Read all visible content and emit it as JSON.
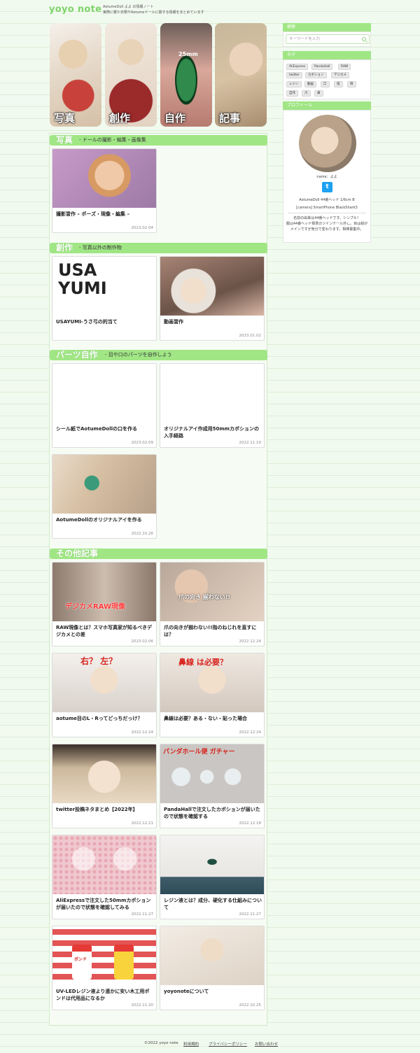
{
  "site": {
    "logo": "yoyo note",
    "tagline": "AotumeDoll よよ の情報ノート\n実際に着た衣類やAotumeドールに関する情報をまとめています"
  },
  "hero": [
    {
      "label": "写真",
      "marker": ""
    },
    {
      "label": "創作",
      "marker": ""
    },
    {
      "label": "自作",
      "marker": "25mm"
    },
    {
      "label": "記事",
      "marker": ""
    }
  ],
  "sections": {
    "photo": {
      "title": "写真",
      "sub": "- ドールの撮影・編集・画像集",
      "cards": [
        {
          "title": "撮影習作 – ポーズ・現像・編集 –",
          "date": "2023.02.04"
        }
      ]
    },
    "creation": {
      "title": "創作",
      "sub": "- 写真以外の制作物",
      "cards": [
        {
          "title": "USAYUMI-うさ弓の的当て",
          "date": "",
          "thumb_text": "USA\nYUMI"
        },
        {
          "title": "動画習作",
          "date": "2023.01.02"
        }
      ]
    },
    "parts": {
      "title": "パーツ自作",
      "sub": "- 目や口のパーツを自作しよう",
      "cards": [
        {
          "title": "シール紙でAotumeDollの口を作る",
          "date": "2023.02.09"
        },
        {
          "title": "オリジナルアイ作成用50mmカボションの入手経路",
          "date": "2022.11.19"
        },
        {
          "title": "AotumeDollのオリジナルアイを作る",
          "date": "2022.10.26"
        }
      ]
    },
    "other": {
      "title": "その他記事",
      "cards": [
        {
          "title": "RAW現像とは？スマホ写真家が知るべきデジカメとの差",
          "date": "2023.02.06",
          "thumb_text": "デジカメRAW現像"
        },
        {
          "title": "爪の向きが揃わない!!指のねじれを直すには？",
          "date": "2022.12.24",
          "thumb_text": "爪の向き 揃わない!!"
        },
        {
          "title": "aotume目のL・Rってどっちだっけ？",
          "date": "2022.12.24",
          "thumb_text": "右？ 左？"
        },
        {
          "title": "鼻線は必要？ある・ない・貼った場合",
          "date": "2022.12.24",
          "thumb_text": "鼻線 は必要？"
        },
        {
          "title": "twitter投稿ネタまとめ【2022年】",
          "date": "2022.12.21"
        },
        {
          "title": "PandaHallで注文したカボションが届いたので状態を確認する",
          "date": "2022.12.18",
          "thumb_text": "パンダホール便 ガチャー"
        },
        {
          "title": "AliExpressで注文した50mmカボションが届いたので状態を確認してみる",
          "date": "2022.11.27"
        },
        {
          "title": "レジン液とは？成分、硬化する仕組みについて",
          "date": "2022.11.27"
        },
        {
          "title": "UV-LEDレジン液より遥かに安い木工用ボンドは代用品になるか",
          "date": "2022.11.20",
          "thumb_text": "ボンド"
        },
        {
          "title": "yoyonoteについて",
          "date": "2022.10.25"
        }
      ]
    }
  },
  "sidebar": {
    "search_head": "検索",
    "search_placeholder": "キーワードを入力",
    "tags_head": "タグ",
    "tags": [
      "AliExpress",
      "PandaHall",
      "RAW",
      "twitter",
      "カボション",
      "デジカメ",
      "レジン",
      "動画",
      "口",
      "指",
      "目",
      "自作",
      "爪",
      "鼻"
    ],
    "profile_head": "プロフィール",
    "name": "name：よよ",
    "spec1": "AotumeDoll 44番ヘッド 1/6cm B",
    "spec2": "[camera] SmartPhone BlackShark3",
    "bio": "名前の由来は44番ヘッドです。シンプル！\n服は44番ヘッド標準のツインテール外し。目は緑が\nメインですが気分で変わります。相棒募集中。"
  },
  "footer": {
    "copyright": "©2022 yoyo note",
    "links": [
      "利用規約",
      "プライバシーポリシー",
      "お問い合わせ"
    ]
  }
}
